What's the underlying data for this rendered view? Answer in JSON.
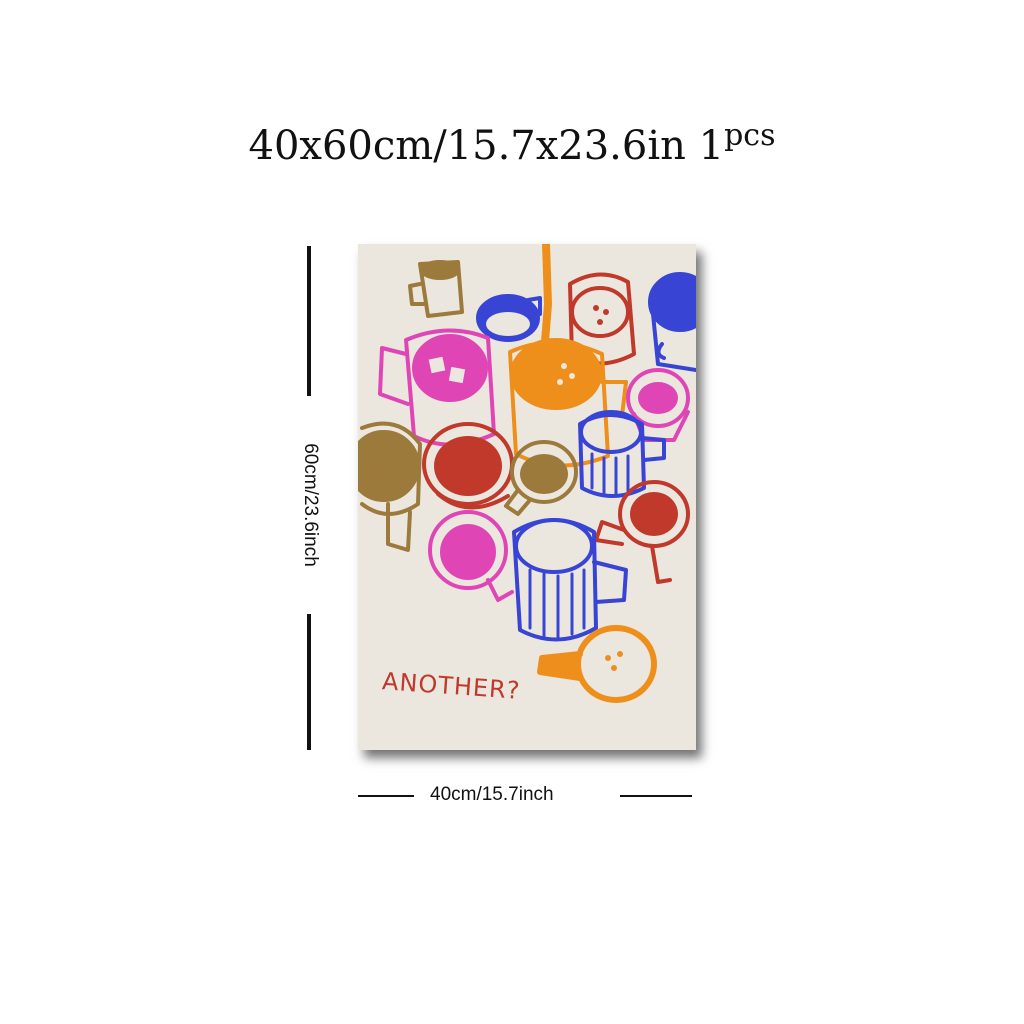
{
  "title": {
    "size_text": "40x60cm/15.7x23.6in",
    "quantity": "1",
    "quantity_unit": "pcs"
  },
  "poster": {
    "caption": "ANOTHER?",
    "background_color": "#ebe7df",
    "colors": {
      "red": "#c0392b",
      "orange": "#ee8f1c",
      "blue": "#3845d4",
      "pink": "#e045b6",
      "brown": "#9c7a3c"
    }
  },
  "dimensions": {
    "height_label": "60cm/23.6inch",
    "width_label": "40cm/15.7inch"
  }
}
